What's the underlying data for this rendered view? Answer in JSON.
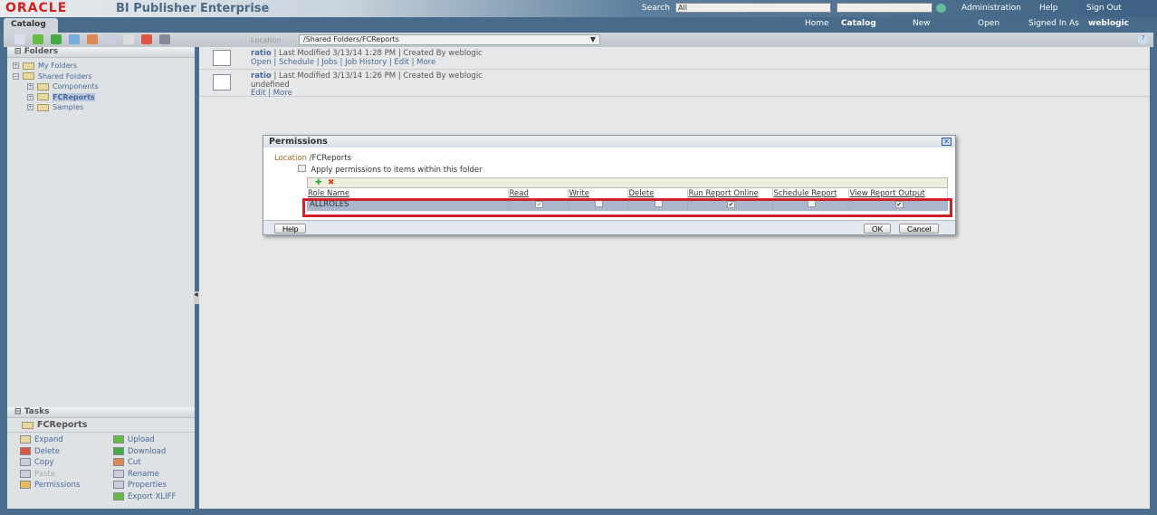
{
  "header": {
    "logo": "ORACLE",
    "title": "BI Publisher Enterprise",
    "search_label": "Search",
    "search_scope": "All",
    "search_value": "",
    "links": [
      "Administration",
      "Help",
      "Sign Out"
    ]
  },
  "nav": {
    "tab": "Catalog",
    "links": [
      "Home",
      "Catalog",
      "New",
      "Open"
    ],
    "signed_in_label": "Signed In As",
    "user": "weblogic"
  },
  "toolbar": {
    "location_label": "Location",
    "location_value": "/Shared Folders/FCReports"
  },
  "folders": {
    "title": "Folders",
    "items": [
      "My Folders",
      "Shared Folders",
      "Components",
      "FCReports",
      "Samples"
    ]
  },
  "items": [
    {
      "name": "ratio",
      "meta": "| Last Modified 3/13/14 1:28 PM | Created By weblogic",
      "desc": "",
      "actions": "Open | Schedule | Jobs | Job History | Edit | More"
    },
    {
      "name": "ratio",
      "meta": "| Last Modified 3/13/14 1:26 PM | Created By weblogic",
      "desc": "undefined",
      "actions": "Edit | More"
    }
  ],
  "tasks": {
    "title": "Tasks",
    "folder": "FCReports",
    "left": [
      "Expand",
      "Delete",
      "Copy",
      "Paste",
      "Permissions"
    ],
    "right": [
      "Upload",
      "Download",
      "Cut",
      "Rename",
      "Properties",
      "Export XLIFF"
    ]
  },
  "dialog": {
    "title": "Permissions",
    "location_label": "Location",
    "location_value": "/FCReports",
    "apply_label": "Apply permissions to items within this folder",
    "columns": [
      "Role Name",
      "Read",
      "Write",
      "Delete",
      "Run Report Online",
      "Schedule Report",
      "View Report Output"
    ],
    "row": {
      "role": "ALLROLES",
      "read": true,
      "write": false,
      "delete": false,
      "run_online": true,
      "schedule": false,
      "view_output": true
    },
    "help": "Help",
    "ok": "OK",
    "cancel": "Cancel"
  }
}
